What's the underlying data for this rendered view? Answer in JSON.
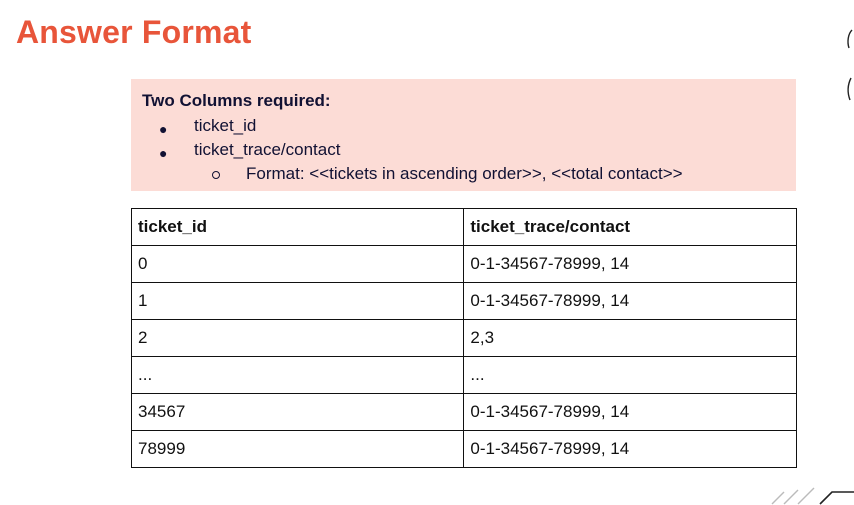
{
  "slide": {
    "title": "Answer Format"
  },
  "requirements": {
    "heading": "Two Columns required:",
    "items": [
      {
        "label": "ticket_id"
      },
      {
        "label": "ticket_trace/contact"
      }
    ],
    "sub_item": "Format: <<tickets in ascending order>>, <<total contact>>"
  },
  "table": {
    "headers": [
      "ticket_id",
      "ticket_trace/contact"
    ],
    "rows": [
      [
        "0",
        "0-1-34567-78999, 14"
      ],
      [
        "1",
        "0-1-34567-78999, 14"
      ],
      [
        "2",
        "2,3"
      ],
      [
        "...",
        "..."
      ],
      [
        "34567",
        "0-1-34567-78999, 14"
      ],
      [
        "78999",
        "0-1-34567-78999, 14"
      ]
    ]
  },
  "colors": {
    "title": "#e8553a",
    "box_background": "#fcdcd6",
    "text": "#111133"
  }
}
